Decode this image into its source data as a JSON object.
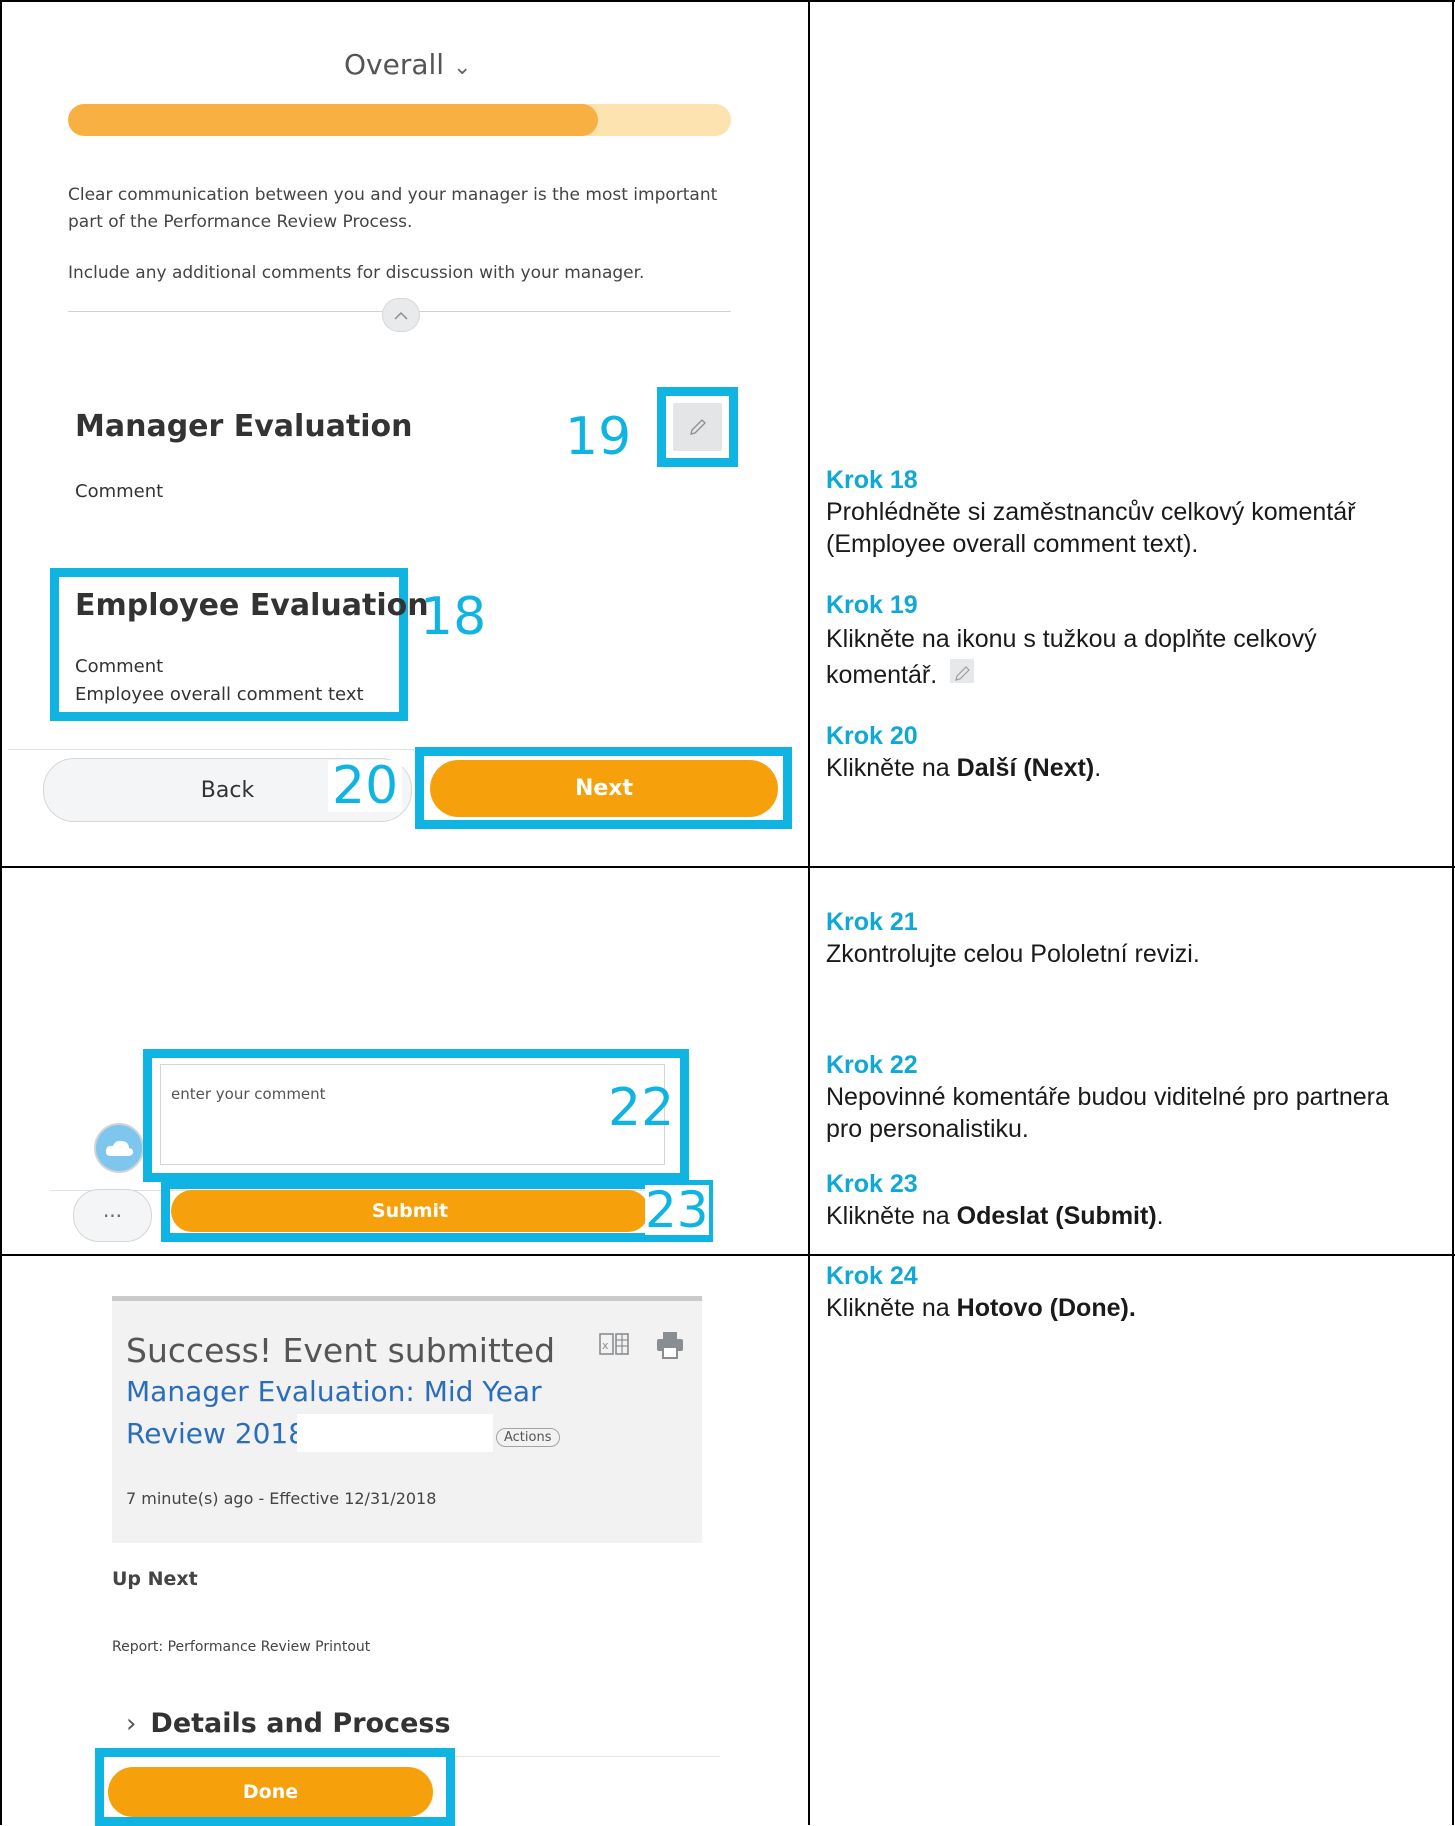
{
  "top": {
    "overall_label": "Overall",
    "overall_chevron": "⌄",
    "progress_value": 0.8,
    "progress_color": "#f9b043",
    "progress_track_color": "#fde3b0",
    "intro_text": "Clear communication between you and your manager is the most important part of the Performance Review Process.",
    "intro_text2": "Include any additional comments for discussion with your manager.",
    "manager_title": "Manager Evaluation",
    "manager_comment_label": "Comment",
    "employee_title": "Employee Evaluation",
    "employee_comment_label": "Comment",
    "employee_comment_text": "Employee overall comment text",
    "back_label": "Back",
    "next_label": "Next",
    "num_18": "18",
    "num_19": "19",
    "num_20": "20"
  },
  "middle": {
    "comment_placeholder": "enter your comment",
    "submit_label": "Submit",
    "more_label": "···",
    "num_22": "22",
    "num_23": "23"
  },
  "bottom": {
    "success_title": "Success! Event submitted",
    "event_link_line1": "Manager Evaluation: Mid Year",
    "event_link_line2": "Review 2018:",
    "actions_label": "Actions",
    "timestamp": "7 minute(s) ago - Effective 12/31/2018",
    "up_next_label": "Up Next",
    "report_label": "Report: Performance Review Printout",
    "details_label": "Details and Process",
    "done_label": "Done"
  },
  "instructions": {
    "krok18_title": "Krok 18",
    "krok18_text": "Prohlédněte si zaměstnancův celkový komentář (Employee overall comment text).",
    "krok19_title": "Krok 19",
    "krok19_text": "Klikněte na ikonu s tužkou a doplňte celkový komentář.",
    "krok20_title": "Krok 20",
    "krok20_pre": "Klikněte na ",
    "krok20_bold": "Další (Next)",
    "krok20_post": ".",
    "krok21_title": "Krok 21",
    "krok21_text": "Zkontrolujte celou Pololetní revizi.",
    "krok22_title": "Krok 22",
    "krok22_text": "Nepovinné komentáře budou viditelné pro partnera pro personalistiku.",
    "krok23_title": "Krok 23",
    "krok23_pre": "Klikněte na ",
    "krok23_bold": "Odeslat (Submit)",
    "krok23_post": ".",
    "krok24_title": "Krok 24",
    "krok24_pre": "Klikněte na ",
    "krok24_bold": "Hotovo (Done)."
  },
  "colors": {
    "highlight": "#10b4e2",
    "accent_orange": "#f6a10c",
    "link_blue": "#2a6ebb"
  }
}
